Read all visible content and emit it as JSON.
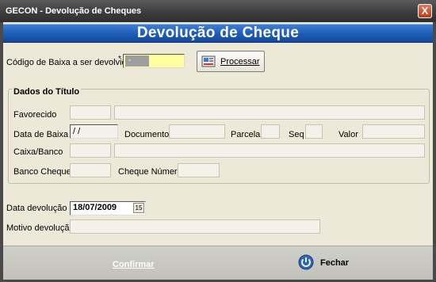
{
  "window": {
    "title": "GECON - Devolução de Cheques",
    "close_symbol": "X"
  },
  "banner": {
    "title": "Devolução de Cheque"
  },
  "codigo": {
    "label": "Código de Baixa a ser devolvido",
    "required_mark": "*",
    "value": "-",
    "highlight_color": "#ffffa0"
  },
  "processar_button": {
    "label": "Processar",
    "icon": "process-icon"
  },
  "dados_titulo": {
    "title": "Dados do Título",
    "favorecido_label": "Favorecido",
    "data_baixa_label": "Data de Baixa",
    "data_baixa_value": " / /",
    "documento_label": "Documento",
    "parcela_label": "Parcela",
    "seq_label": "Seq",
    "valor_label": "Valor",
    "caixa_banco_label": "Caixa/Banco",
    "banco_cheque_label": "Banco Cheque",
    "cheque_numero_label": "Cheque Número"
  },
  "data_devolucao": {
    "label": "Data devolução",
    "value": "18/07/2009",
    "picker_text": "15"
  },
  "motivo_devolucao": {
    "label": "Motivo devolução",
    "value": ""
  },
  "footer": {
    "confirmar_label": "Confirmar",
    "fechar_label": "Fechar",
    "fechar_icon": "power-icon"
  }
}
